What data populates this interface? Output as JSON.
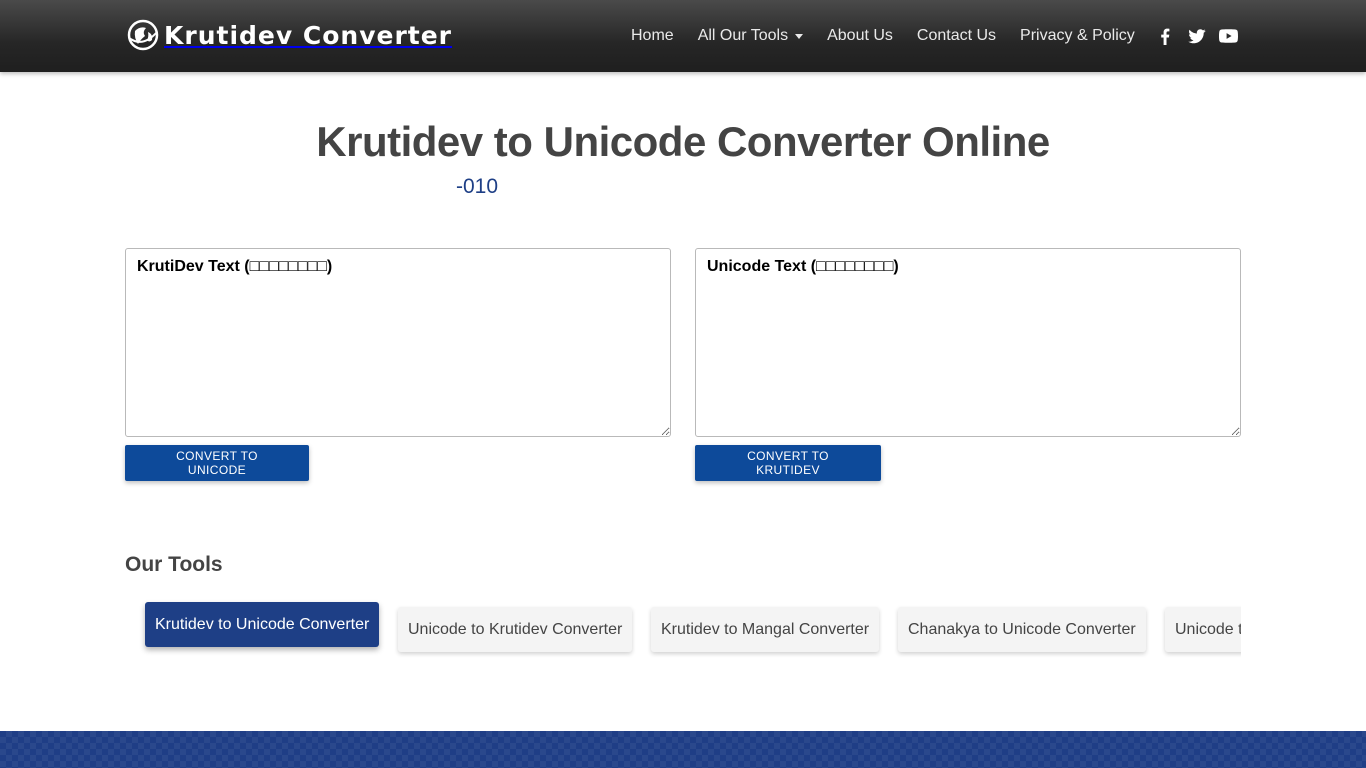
{
  "navbar": {
    "brand": "Krutidev Converter",
    "links": [
      {
        "label": "Home"
      },
      {
        "label": "All Our Tools"
      },
      {
        "label": "About Us"
      },
      {
        "label": "Contact Us"
      },
      {
        "label": "Privacy & Policy"
      }
    ],
    "social_icons": [
      "facebook-icon",
      "twitter-icon",
      "youtube-icon"
    ]
  },
  "main": {
    "title": "Krutidev to Unicode Converter Online",
    "subtitle": "-010",
    "left": {
      "placeholder": "KrutiDev Text (□□□□□□□□)",
      "button": "Convert to Unicode"
    },
    "right": {
      "placeholder": "Unicode Text (□□□□□□□□)",
      "button": "Convert to Krutidev"
    }
  },
  "tools": {
    "heading": "Our Tools",
    "items": [
      {
        "label": "Krutidev to Unicode Converter",
        "active": true
      },
      {
        "label": "Unicode to Krutidev Converter"
      },
      {
        "label": "Krutidev to Mangal Converter"
      },
      {
        "label": "Chanakya to Unicode Converter"
      },
      {
        "label": "Unicode to Chanakya Converter"
      }
    ]
  },
  "colors": {
    "accent": "#1e3f86",
    "button": "#0d4a9a",
    "navbar": "#2b2b2b"
  }
}
